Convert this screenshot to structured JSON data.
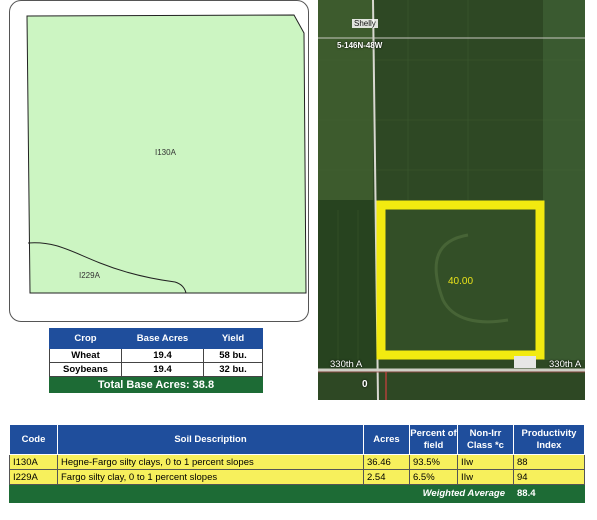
{
  "soil_map": {
    "units": [
      {
        "code": "I130A",
        "color": "#ccf5c2"
      },
      {
        "code": "I229A",
        "color": "#ccf5c2"
      }
    ],
    "boundary_color": "#222222"
  },
  "aerial": {
    "town_label": "Shelly",
    "section_label": "5-146N-48W",
    "tract_acres": "40.00",
    "road_label_left": "330th A",
    "road_label_right": "330th A",
    "route_label": "0",
    "tract_outline_color": "#f2ea10"
  },
  "base_acres": {
    "headers": [
      "Crop",
      "Base Acres",
      "Yield"
    ],
    "rows": [
      {
        "crop": "Wheat",
        "base_acres": "19.4",
        "yield": "58 bu."
      },
      {
        "crop": "Soybeans",
        "base_acres": "19.4",
        "yield": "32 bu."
      }
    ],
    "total_label": "Total Base Acres:",
    "total_value": "38.8"
  },
  "soil_table": {
    "headers": {
      "code": "Code",
      "description": "Soil Description",
      "acres": "Acres",
      "percent": "Percent of field",
      "class": "Non-Irr Class *c",
      "productivity": "Productivity Index"
    },
    "rows": [
      {
        "code": "I130A",
        "description": "Hegne-Fargo silty clays, 0 to 1 percent slopes",
        "acres": "36.46",
        "percent": "93.5%",
        "class": "IIw",
        "productivity": "88"
      },
      {
        "code": "I229A",
        "description": "Fargo silty clay, 0 to 1 percent slopes",
        "acres": "2.54",
        "percent": "6.5%",
        "class": "IIw",
        "productivity": "94"
      }
    ],
    "weighted_average_label": "Weighted Average",
    "weighted_average_value": "88.4"
  },
  "colors": {
    "header_blue": "#1f4e9c",
    "total_green": "#1d6b35",
    "row_yellow": "#f7f05c"
  }
}
